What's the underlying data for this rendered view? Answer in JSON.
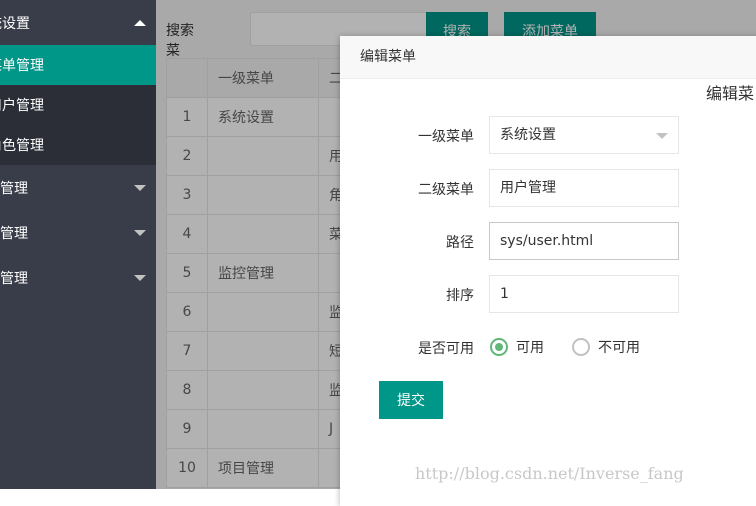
{
  "sidebar": {
    "group_top": {
      "label": "统设置"
    },
    "items": [
      {
        "label": "菜单管理"
      },
      {
        "label": "用户管理"
      },
      {
        "label": "角色管理"
      }
    ],
    "groups": [
      {
        "label": "控管理"
      },
      {
        "label": "目管理"
      },
      {
        "label": "他管理"
      }
    ]
  },
  "toolbar": {
    "search_label": "搜索菜单：",
    "search_button": "搜索",
    "add_button": "添加菜单"
  },
  "table": {
    "headers": [
      "",
      "一级菜单",
      "二"
    ],
    "rows": [
      {
        "num": "1",
        "c1": "系统设置",
        "c2": ""
      },
      {
        "num": "2",
        "c1": "",
        "c2": "用"
      },
      {
        "num": "3",
        "c1": "",
        "c2": "角"
      },
      {
        "num": "4",
        "c1": "",
        "c2": "菜"
      },
      {
        "num": "5",
        "c1": "监控管理",
        "c2": ""
      },
      {
        "num": "6",
        "c1": "",
        "c2": "监"
      },
      {
        "num": "7",
        "c1": "",
        "c2": "短"
      },
      {
        "num": "8",
        "c1": "",
        "c2": "监"
      },
      {
        "num": "9",
        "c1": "",
        "c2": "J"
      },
      {
        "num": "10",
        "c1": "项目管理",
        "c2": ""
      }
    ]
  },
  "modal": {
    "title": "编辑菜单",
    "subtitle": "编辑菜",
    "fields": {
      "level1": {
        "label": "一级菜单",
        "value": "系统设置"
      },
      "level2": {
        "label": "二级菜单",
        "value": "用户管理"
      },
      "path": {
        "label": "路径",
        "value": "sys/user.html"
      },
      "order": {
        "label": "排序",
        "value": "1"
      },
      "enabled": {
        "label": "是否可用",
        "options": [
          "可用",
          "不可用"
        ],
        "selected": "可用"
      }
    },
    "submit_label": "提交"
  },
  "watermark": "http://blog.csdn.net/Inverse_fang",
  "colors": {
    "accent": "#009688",
    "sidebar": "#393d49",
    "radio_on": "#5fb878"
  }
}
